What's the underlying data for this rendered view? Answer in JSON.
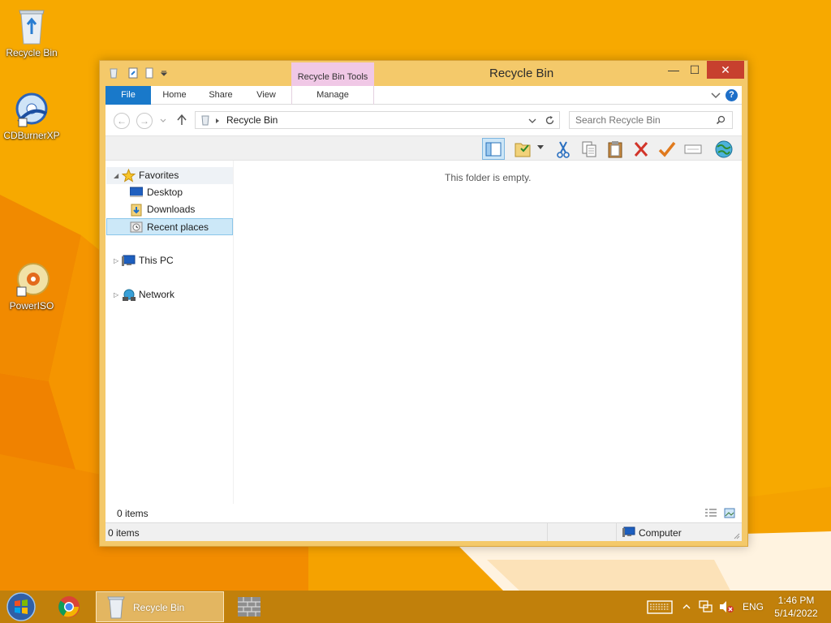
{
  "desktop": {
    "icons": [
      {
        "label": "Recycle Bin",
        "icon": "recycle-bin-icon"
      },
      {
        "label": "CDBurnerXP",
        "icon": "cdburnerxp-icon"
      },
      {
        "label": "PowerISO",
        "icon": "poweriso-icon"
      }
    ]
  },
  "window": {
    "title": "Recycle Bin",
    "contextual_tab_header": "Recycle Bin Tools",
    "controls": {
      "minimize": "—",
      "maximize": "☐",
      "close": "✕"
    }
  },
  "ribbon": {
    "tabs": [
      "File",
      "Home",
      "Share",
      "View",
      "Manage"
    ],
    "help": "?"
  },
  "navigation": {
    "breadcrumb": "Recycle Bin",
    "search_placeholder": "Search Recycle Bin"
  },
  "nav_pane": {
    "favorites_label": "Favorites",
    "favorites": [
      "Desktop",
      "Downloads",
      "Recent places"
    ],
    "this_pc_label": "This PC",
    "network_label": "Network",
    "selected": "Recent places"
  },
  "content": {
    "empty_message": "This folder is empty."
  },
  "details": {
    "item_count": "0 items"
  },
  "status_bar": {
    "item_count": "0 items",
    "location": "Computer"
  },
  "taskbar": {
    "active_window_label": "Recycle Bin",
    "language": "ENG",
    "time": "1:46 PM",
    "date": "5/14/2022"
  },
  "colors": {
    "wallpaper": "#f6a800",
    "window_frame": "#f4c96a",
    "file_tab": "#1979ca",
    "contextual_tab": "#f0c8e6",
    "close_button": "#c7402e"
  }
}
